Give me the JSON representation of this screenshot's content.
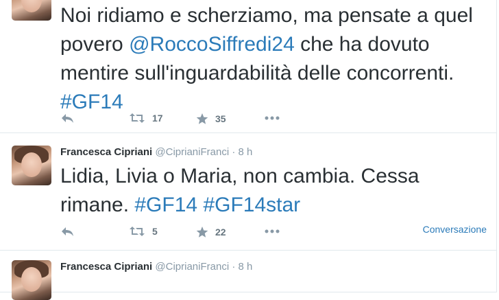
{
  "tweets": [
    {
      "text_parts": [
        "Noi ridiamo e scherziamo, ma pensate a quel povero ",
        "@RoccoSiffredi24",
        " che ha dovuto mentire sull'inguardabilità delle concorrenti. ",
        "#GF14"
      ],
      "retweets": "17",
      "favorites": "35"
    },
    {
      "fullname": "Francesca Cipriani",
      "username": "@CiprianiFranci",
      "separator": "·",
      "time": "8 h",
      "text_parts": [
        "Lidia, Livia o Maria, non cambia. Cessa rimane. ",
        "#GF14",
        " ",
        "#GF14star"
      ],
      "retweets": "5",
      "favorites": "22",
      "conversation_label": "Conversazione"
    },
    {
      "fullname": "Francesca Cipriani",
      "username": "@CiprianiFranci",
      "separator": "·",
      "time": "8 h"
    }
  ],
  "icons": {
    "reply": "reply-icon",
    "retweet": "retweet-icon",
    "favorite": "star-icon",
    "more": "more-icon"
  },
  "colors": {
    "link": "#2b7bb9",
    "muted": "#8899a6",
    "text": "#292f33",
    "border": "#e1e8ed"
  }
}
